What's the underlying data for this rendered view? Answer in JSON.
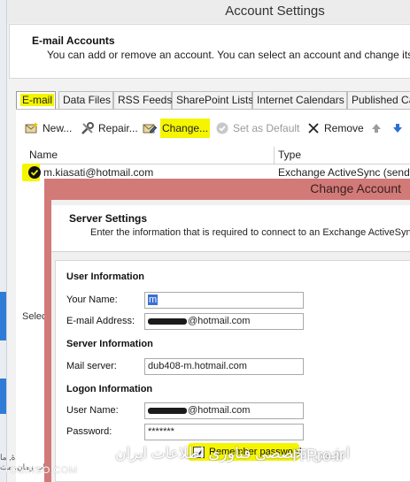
{
  "account_settings": {
    "title": "Account Settings",
    "header_title": "E-mail Accounts",
    "header_subtitle": "You can add or remove an account. You can select an account and change its set",
    "tabs": [
      "E-mail",
      "Data Files",
      "RSS Feeds",
      "SharePoint Lists",
      "Internet Calendars",
      "Published Ca"
    ],
    "toolbar": {
      "new": "New...",
      "repair": "Repair...",
      "change": "Change...",
      "set_default": "Set as Default",
      "remove": "Remove"
    },
    "columns": {
      "name": "Name",
      "type": "Type"
    },
    "account_row": {
      "name": "m.kiasati@hotmail.com",
      "type": "Exchange ActiveSync (send fro"
    },
    "selected_label": "Selec",
    "bottom_left_text": "ۀ, ما\nباب زمان، مث"
  },
  "change_account": {
    "title": "Change Account",
    "server_settings_title": "Server Settings",
    "server_settings_subtitle": "Enter the information that is required to connect to an Exchange ActiveSync",
    "sections": {
      "user_info": "User Information",
      "server_info": "Server Information",
      "logon_info": "Logon Information"
    },
    "fields": {
      "your_name_label": "Your Name:",
      "your_name_value": "m",
      "email_label": "E-mail Address:",
      "email_value": "@hotmail.com",
      "mail_server_label": "Mail server:",
      "mail_server_value": "dub408-m.hotmail.com",
      "user_name_label": "User Name:",
      "user_name_value": "@hotmail.com",
      "password_label": "Password:",
      "password_value": "*******"
    },
    "remember_password_label": "Remember password",
    "remember_password_checked": true
  },
  "watermarks": {
    "left": "TOSINSO.COM",
    "middle": "انجمن تخصصی فناوری اطلاعات ایران",
    "right": "ITPro.ir"
  },
  "colors": {
    "highlight": "#f5f500",
    "dialog_frame": "#d27a78",
    "selection": "#3b6fd6"
  }
}
